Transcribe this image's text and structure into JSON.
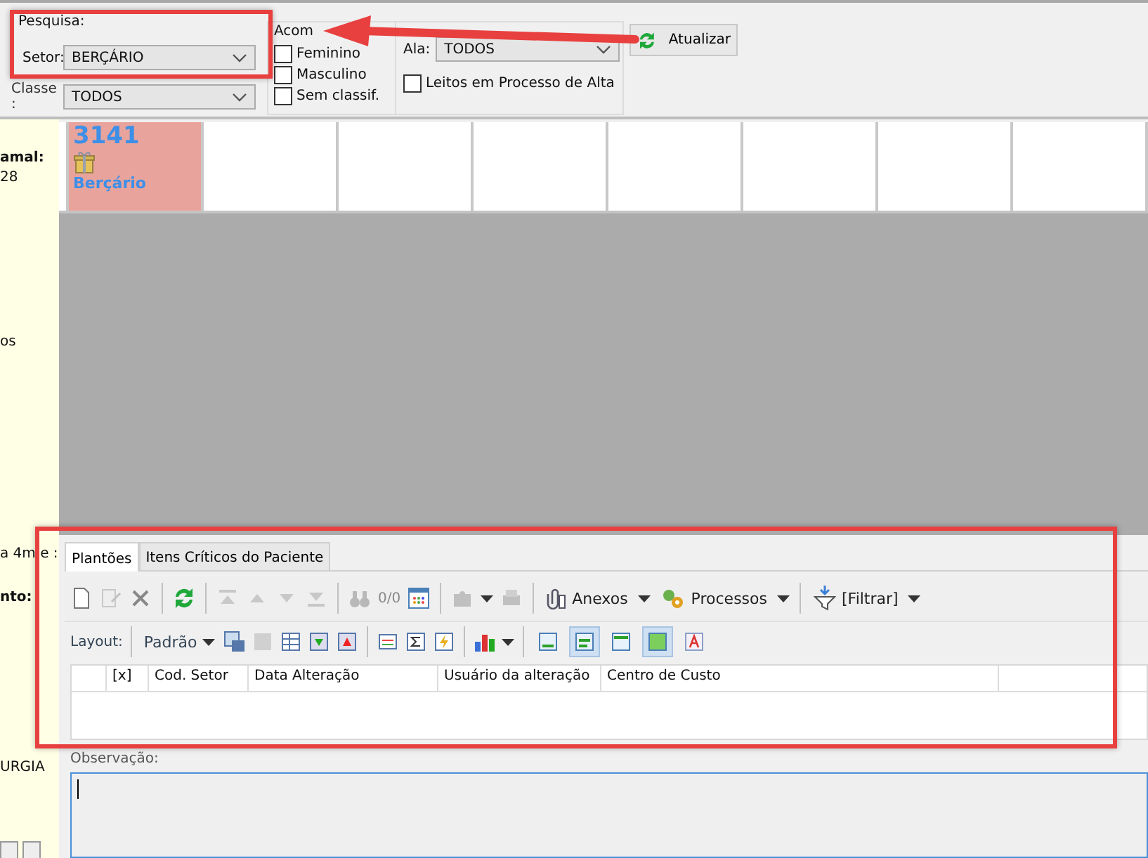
{
  "search_panel": {
    "title": "Pesquisa:",
    "setor": {
      "label": "Setor:",
      "value": "BERÇÁRIO"
    },
    "classe": {
      "label": "Classe :",
      "value": "TODOS"
    },
    "acomodacao": {
      "title": "Acom",
      "options": [
        {
          "label": "Feminino",
          "checked": false
        },
        {
          "label": "Masculino",
          "checked": false
        },
        {
          "label": "Sem classif.",
          "checked": false
        }
      ]
    },
    "ala": {
      "label": "Ala:",
      "value": "TODOS"
    },
    "leitos_alta": {
      "label": "Leitos em Processo de Alta",
      "checked": false
    },
    "refresh_button": "Atualizar"
  },
  "sidebar_texts": [
    {
      "text": "amal:",
      "bold": true
    },
    {
      "text": "28",
      "bold": false
    },
    {
      "text": "os",
      "bold": false
    },
    {
      "text": "a 4m e :",
      "bold": false
    },
    {
      "text": "nto:",
      "bold": true
    },
    {
      "text": "URGIA",
      "bold": false
    }
  ],
  "beds": [
    {
      "number": "3141",
      "sector": "Berçário",
      "occupied": true
    },
    {
      "occupied": false
    },
    {
      "occupied": false
    },
    {
      "occupied": false
    },
    {
      "occupied": false
    },
    {
      "occupied": false
    },
    {
      "occupied": false
    },
    {
      "occupied": false
    }
  ],
  "tabs": [
    {
      "label": "Plantões",
      "selected": true
    },
    {
      "label": "Itens Críticos do Paciente",
      "selected": false
    }
  ],
  "toolbar": {
    "pager": "0/0",
    "attachments": "Anexos",
    "processes": "Processos",
    "filter": "[Filtrar]"
  },
  "layout_toolbar": {
    "label": "Layout:",
    "preset": "Padrão",
    "view_toggles": [
      {
        "selected": false
      },
      {
        "selected": true
      },
      {
        "selected": false
      },
      {
        "selected": true
      },
      {
        "selected": false
      }
    ]
  },
  "table": {
    "columns": [
      "[x]",
      "Cod. Setor",
      "Data Alteração",
      "Usuário da alteração",
      "Centro de Custo"
    ]
  },
  "observacao": {
    "label": "Observação:"
  }
}
